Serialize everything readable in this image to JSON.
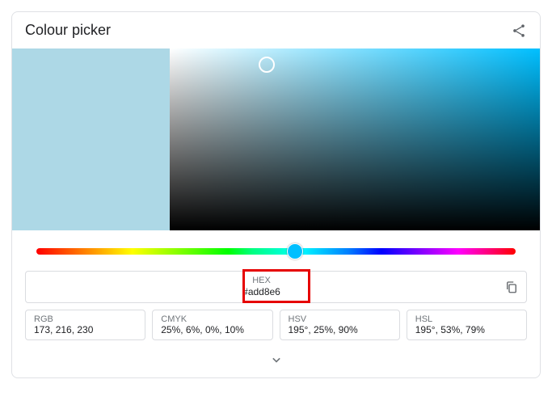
{
  "title": "Colour picker",
  "selected_color": "#add8e6",
  "hex": {
    "label": "HEX",
    "value": "#add8e6"
  },
  "formats": [
    {
      "label": "RGB",
      "value": "173, 216, 230"
    },
    {
      "label": "CMYK",
      "value": "25%, 6%, 0%, 10%"
    },
    {
      "label": "HSV",
      "value": "195°, 25%, 90%"
    },
    {
      "label": "HSL",
      "value": "195°, 53%, 79%"
    }
  ]
}
